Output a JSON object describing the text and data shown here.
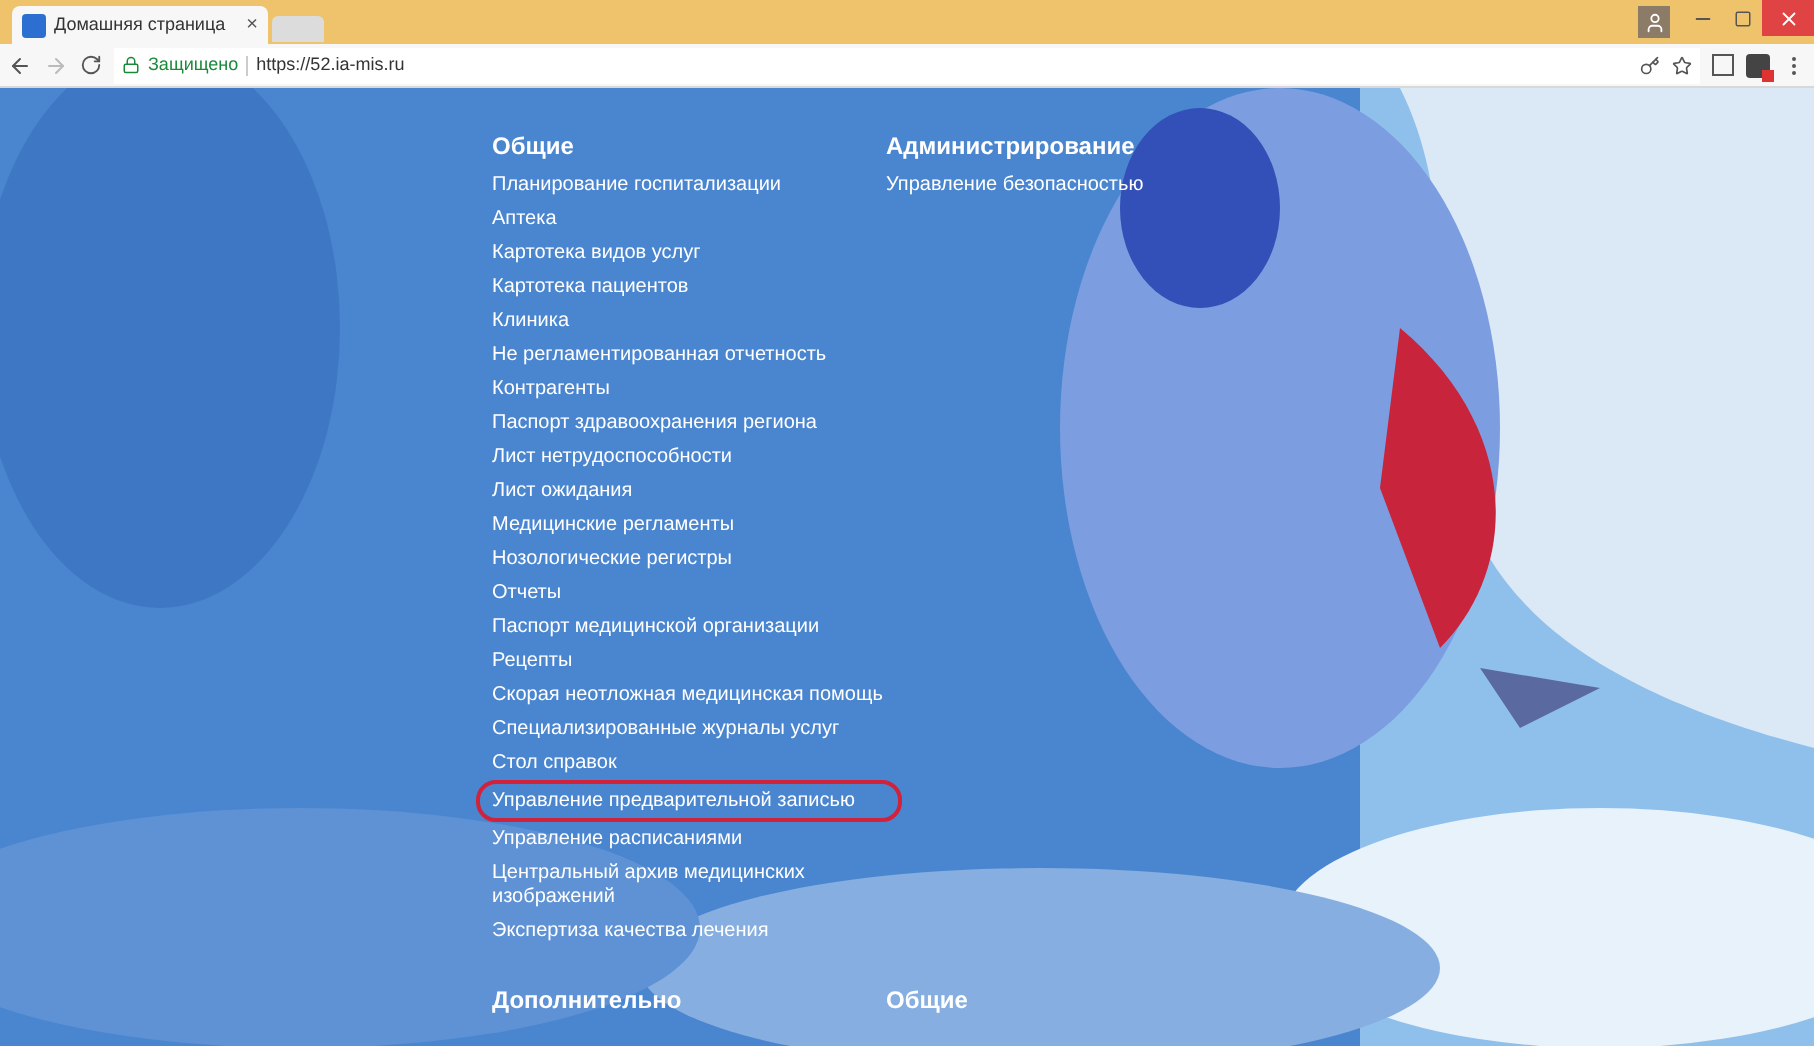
{
  "browser": {
    "tab": {
      "title": "Домашняя страница",
      "close": "×"
    },
    "address": {
      "secure_label": "Защищено",
      "url": "https://52.ia-mis.ru"
    }
  },
  "sections": [
    {
      "title": "Общие",
      "items": [
        {
          "label": "Планирование госпитализации",
          "highlighted": false
        },
        {
          "label": "Аптека",
          "highlighted": false
        },
        {
          "label": "Картотека видов услуг",
          "highlighted": false
        },
        {
          "label": "Картотека пациентов",
          "highlighted": false
        },
        {
          "label": "Клиника",
          "highlighted": false
        },
        {
          "label": "Не регламентированная отчетность",
          "highlighted": false
        },
        {
          "label": "Контрагенты",
          "highlighted": false
        },
        {
          "label": "Паспорт здравоохранения региона",
          "highlighted": false
        },
        {
          "label": "Лист нетрудоспособности",
          "highlighted": false
        },
        {
          "label": "Лист ожидания",
          "highlighted": false
        },
        {
          "label": "Медицинские регламенты",
          "highlighted": false
        },
        {
          "label": "Нозологические регистры",
          "highlighted": false
        },
        {
          "label": "Отчеты",
          "highlighted": false
        },
        {
          "label": "Паспорт медицинской организации",
          "highlighted": false
        },
        {
          "label": "Рецепты",
          "highlighted": false
        },
        {
          "label": "Скорая неотложная медицинская помощь",
          "highlighted": false
        },
        {
          "label": "Специализированные журналы услуг",
          "highlighted": false
        },
        {
          "label": "Стол справок",
          "highlighted": false
        },
        {
          "label": "Управление предварительной записью",
          "highlighted": true
        },
        {
          "label": "Управление расписаниями",
          "highlighted": false
        },
        {
          "label": "Центральный архив медицинских изображений",
          "highlighted": false
        },
        {
          "label": "Экспертиза качества лечения",
          "highlighted": false
        }
      ]
    },
    {
      "title": "Администрирование",
      "items": [
        {
          "label": "Управление безопасностью",
          "highlighted": false
        }
      ]
    }
  ],
  "bottom_sections": [
    {
      "title": "Дополнительно"
    },
    {
      "title": "Общие"
    }
  ]
}
